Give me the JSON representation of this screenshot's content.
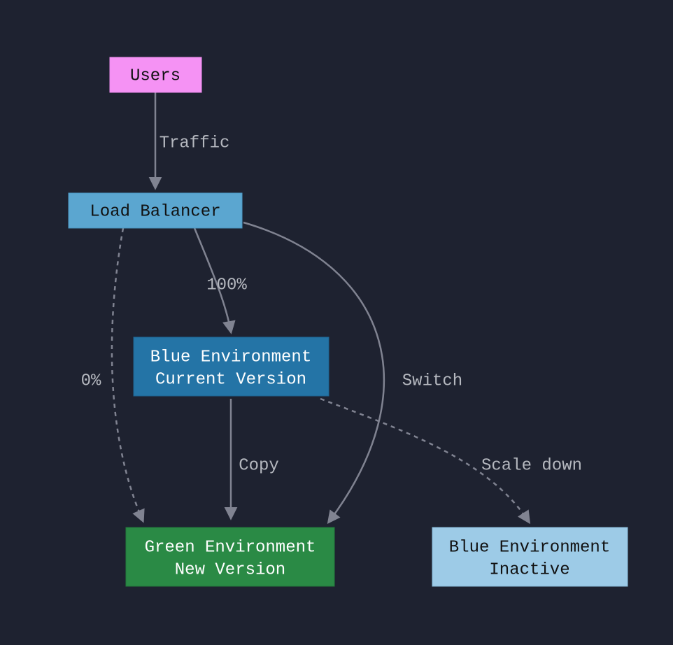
{
  "diagram": {
    "nodes": {
      "users": {
        "label": "Users",
        "fill": "#f592f4",
        "text": "#111111"
      },
      "lb": {
        "label": "Load Balancer",
        "fill": "#5ba6d0",
        "text": "#111111"
      },
      "blue_cur": {
        "line1": "Blue Environment",
        "line2": "Current Version",
        "fill": "#2474a6",
        "text": "#ffffff"
      },
      "green": {
        "line1": "Green Environment",
        "line2": "New Version",
        "fill": "#2a8a45",
        "text": "#ffffff"
      },
      "blue_inactive": {
        "line1": "Blue Environment",
        "line2": "Inactive",
        "fill": "#9dcbe7",
        "text": "#111111"
      }
    },
    "edges": {
      "traffic": "Traffic",
      "lb_blue": "100%",
      "lb_green_dotted": "0%",
      "blue_green": "Copy",
      "lb_green_switch": "Switch",
      "blue_inactive_scale": "Scale down"
    }
  }
}
